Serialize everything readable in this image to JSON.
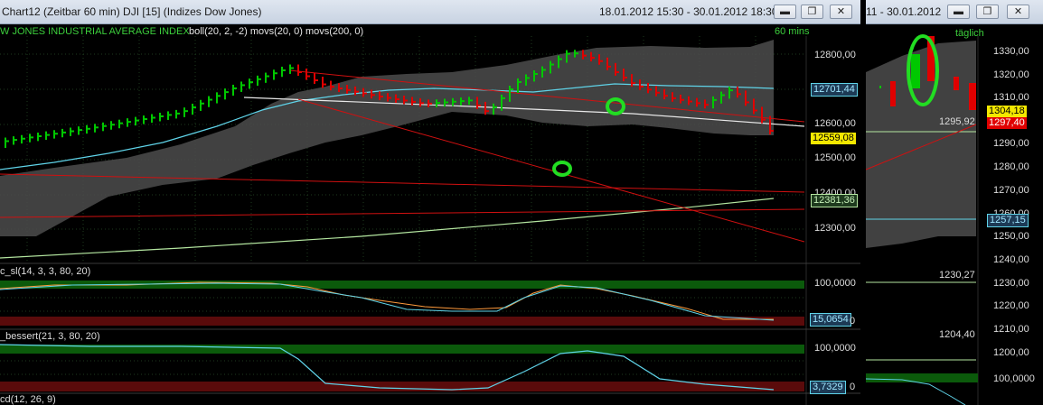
{
  "main": {
    "title": "Chart12 (Zeitbar 60 min)  DJI [15]  (Indizes Dow Jones)",
    "date_range": "18.01.2012 15:30 - 30.01.2012 18:30",
    "header": "W JONES INDUSTRIAL AVERAGE INDEX",
    "indicators": "boll(20, 2, -2) movs(20, 0) movs(200, 0)",
    "timeframe": "60 mins",
    "y_ticks": [
      "12800,00",
      "12700,00",
      "12600,00",
      "12500,00",
      "12400,00",
      "12300,00"
    ],
    "last_price": "12559,08",
    "ma20_value": "12701,44",
    "ma200_value": "12381,36",
    "stoch_label": "c_sl(14, 3, 3, 80, 20)",
    "stoch_high": "100,0000",
    "stoch_value": "15,0654",
    "stoch_low": "0",
    "rsi_label": "_bessert(21, 3, 80, 20)",
    "rsi_high": "100,0000",
    "rsi_value": "3,7329",
    "rsi_low": "0",
    "macd_label": "cd(12, 26, 9)"
  },
  "daily": {
    "title_partial": "11 - 30.01.2012",
    "timeframe": "täglich",
    "y_ticks": [
      "1330,00",
      "1320,00",
      "1310,00",
      "1300,00",
      "1290,00",
      "1280,00",
      "1270,00",
      "1260,00",
      "1250,00",
      "1240,00",
      "1230,00",
      "1220,00",
      "1210,00",
      "1200,00"
    ],
    "last_price": "1304,18",
    "low_price": "1297,40",
    "level_1": "1295,92",
    "ma_value": "1257,15",
    "level_2": "1230,27",
    "level_3": "1204,40",
    "osc_high": "100,0000"
  },
  "window_buttons": {
    "minimize": "▬",
    "restore": "❐",
    "close": "✕"
  },
  "colors": {
    "up": "#00c800",
    "down": "#e00000",
    "ma20": "#5fd3e8",
    "ma200": "#b4e6a0",
    "band": "#5a5a5a",
    "trend": "#d01010",
    "annotation": "#22dd22"
  }
}
